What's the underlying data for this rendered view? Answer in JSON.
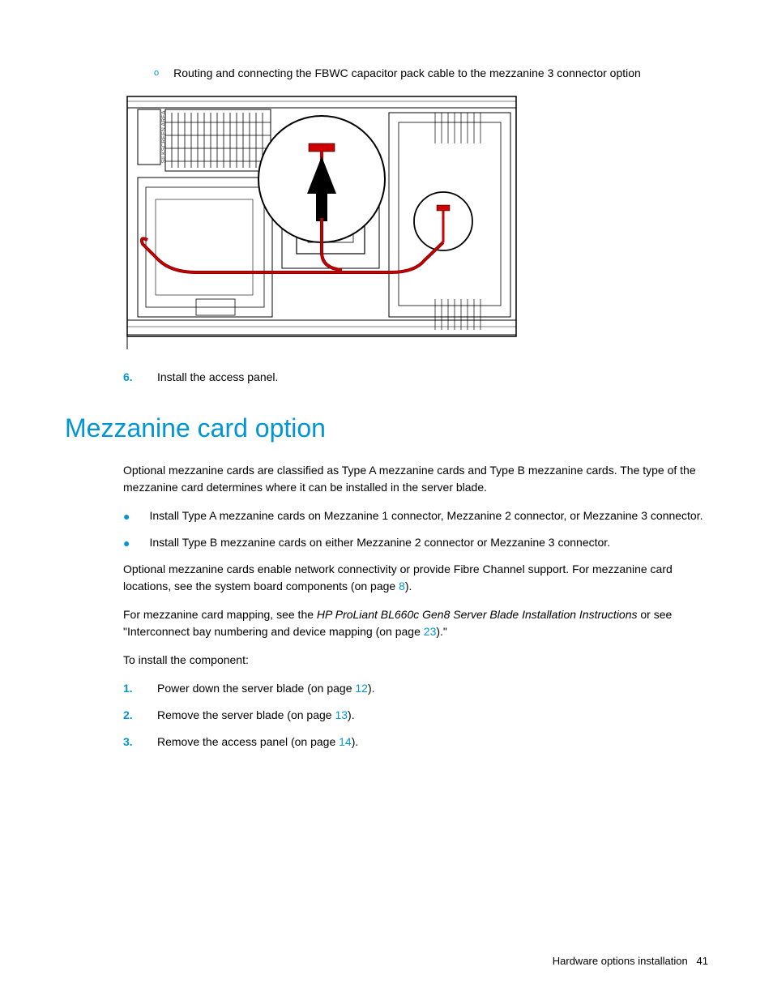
{
  "subList": {
    "bullet": "o",
    "text": "Routing and connecting the FBWC capacitor pack cable to the mezzanine 3 connector option"
  },
  "step6": {
    "number": "6.",
    "text": "Install the access panel."
  },
  "heading": "Mezzanine card option",
  "para1": "Optional mezzanine cards are classified as Type A mezzanine cards and Type B mezzanine cards. The type of the mezzanine card determines where it can be installed in the server blade.",
  "bullets1": [
    "Install Type A mezzanine cards on Mezzanine 1 connector, Mezzanine 2 connector, or Mezzanine 3 connector.",
    "Install Type B mezzanine cards on either Mezzanine 2 connector or Mezzanine 3 connector."
  ],
  "para2": {
    "prefix": "Optional mezzanine cards enable network connectivity or provide Fibre Channel support. For mezzanine card locations, see the system board components (on page ",
    "link": "8",
    "suffix": ")."
  },
  "para3": {
    "prefix": "For mezzanine card mapping, see the ",
    "italic": "HP ProLiant BL660c Gen8 Server Blade Installation Instructions",
    "mid": " or see \"Interconnect bay numbering and device mapping (on page ",
    "link": "23",
    "suffix": ").\""
  },
  "para4": "To install the component:",
  "steps": [
    {
      "num": "1.",
      "prefix": "Power down the server blade (on page ",
      "link": "12",
      "suffix": ")."
    },
    {
      "num": "2.",
      "prefix": "Remove the server blade (on page ",
      "link": "13",
      "suffix": ")."
    },
    {
      "num": "3.",
      "prefix": "Remove the access panel (on page ",
      "link": "14",
      "suffix": ")."
    }
  ],
  "footer": {
    "section": "Hardware options installation",
    "page": "41"
  }
}
